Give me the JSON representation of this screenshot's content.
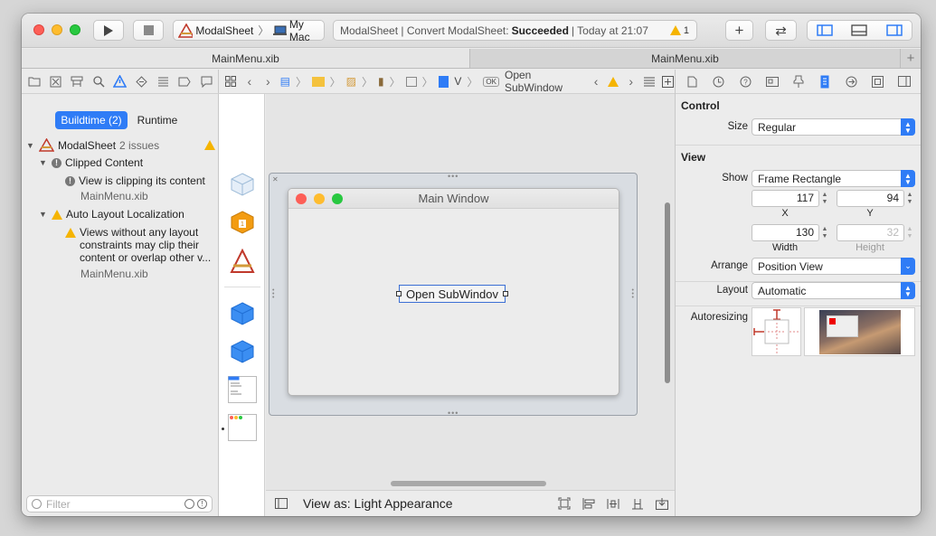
{
  "toolbar": {
    "scheme_name": "ModalSheet",
    "destination": "My Mac",
    "activity": {
      "prefix": "ModalSheet | Convert ModalSheet:",
      "status": "Succeeded",
      "suffix": "| Today at 21:07",
      "warning_count": "1"
    },
    "buttons": {
      "add": "+",
      "swap": "⇄"
    }
  },
  "tabs": [
    "MainMenu.xib",
    "MainMenu.xib"
  ],
  "navigator": {
    "segments": {
      "buildtime": "Buildtime (2)",
      "runtime": "Runtime"
    },
    "project": {
      "name": "ModalSheet",
      "count": "2 issues"
    },
    "groups": [
      {
        "title": "Clipped Content",
        "issue": "View is clipping its content",
        "file": "MainMenu.xib"
      },
      {
        "title": "Auto Layout Localization",
        "issue_lines": [
          "Views without any layout",
          "constraints may clip their",
          "content or overlap other v..."
        ],
        "file": "MainMenu.xib"
      }
    ],
    "filter_placeholder": "Filter"
  },
  "jumpbar": {
    "item_v": "V",
    "button_label": "Open SubWindow"
  },
  "canvas": {
    "window_title": "Main Window",
    "button_label": "Open SubWindov",
    "view_as": "View as: Light Appearance"
  },
  "inspector": {
    "control": {
      "header": "Control",
      "size_label": "Size",
      "size_value": "Regular"
    },
    "view": {
      "header": "View",
      "show_label": "Show",
      "show_value": "Frame Rectangle",
      "x": "117",
      "y": "94",
      "width": "130",
      "height": "32",
      "x_label": "X",
      "y_label": "Y",
      "width_label": "Width",
      "height_label": "Height",
      "arrange_label": "Arrange",
      "arrange_value": "Position View",
      "layout_label": "Layout",
      "layout_value": "Automatic",
      "autoresizing_label": "Autoresizing"
    }
  },
  "colors": {
    "accent": "#2f7cf6",
    "warning": "#f5b400",
    "close": "#fd5f57",
    "minimize": "#febc2e",
    "zoom": "#28c840"
  }
}
